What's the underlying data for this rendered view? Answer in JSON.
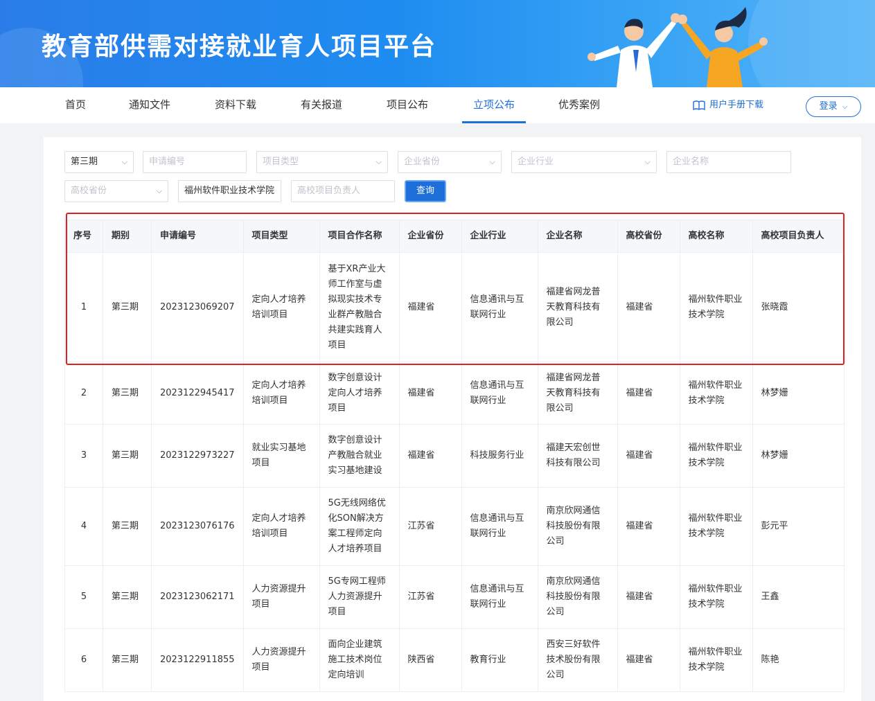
{
  "header": {
    "title": "教育部供需对接就业育人项目平台"
  },
  "nav": {
    "items": [
      {
        "label": "首页"
      },
      {
        "label": "通知文件"
      },
      {
        "label": "资料下载"
      },
      {
        "label": "有关报道"
      },
      {
        "label": "项目公布"
      },
      {
        "label": "立项公布"
      },
      {
        "label": "优秀案例"
      }
    ],
    "active": "立项公布",
    "manual_label": "用户手册下载",
    "login_label": "登录"
  },
  "filters": {
    "period_value": "第三期",
    "application_no_placeholder": "申请编号",
    "project_type_placeholder": "项目类型",
    "enterprise_province_placeholder": "企业省份",
    "enterprise_industry_placeholder": "企业行业",
    "enterprise_name_placeholder": "企业名称",
    "university_province_placeholder": "高校省份",
    "university_name_value": "福州软件职业技术学院",
    "university_leader_placeholder": "高校项目负责人",
    "query_label": "查询"
  },
  "table": {
    "headers": [
      "序号",
      "期别",
      "申请编号",
      "项目类型",
      "项目合作名称",
      "企业省份",
      "企业行业",
      "企业名称",
      "高校省份",
      "高校名称",
      "高校项目负责人"
    ],
    "rows": [
      [
        "1",
        "第三期",
        "2023123069207",
        "定向人才培养培训项目",
        "基于XR产业大师工作室与虚拟现实技术专业群产教融合共建实践育人项目",
        "福建省",
        "信息通讯与互联网行业",
        "福建省网龙普天教育科技有限公司",
        "福建省",
        "福州软件职业技术学院",
        "张晓霞"
      ],
      [
        "2",
        "第三期",
        "2023122945417",
        "定向人才培养培训项目",
        "数字创意设计定向人才培养项目",
        "福建省",
        "信息通讯与互联网行业",
        "福建省网龙普天教育科技有限公司",
        "福建省",
        "福州软件职业技术学院",
        "林梦姗"
      ],
      [
        "3",
        "第三期",
        "2023122973227",
        "就业实习基地项目",
        "数字创意设计产教融合就业实习基地建设",
        "福建省",
        "科技服务行业",
        "福建天宏创世科技有限公司",
        "福建省",
        "福州软件职业技术学院",
        "林梦姗"
      ],
      [
        "4",
        "第三期",
        "2023123076176",
        "定向人才培养培训项目",
        "5G无线网络优化SON解决方案工程师定向人才培养项目",
        "江苏省",
        "信息通讯与互联网行业",
        "南京欣网通信科技股份有限公司",
        "福建省",
        "福州软件职业技术学院",
        "彭元平"
      ],
      [
        "5",
        "第三期",
        "2023123062171",
        "人力资源提升项目",
        "5G专网工程师人力资源提升项目",
        "江苏省",
        "信息通讯与互联网行业",
        "南京欣网通信科技股份有限公司",
        "福建省",
        "福州软件职业技术学院",
        "王鑫"
      ],
      [
        "6",
        "第三期",
        "2023122911855",
        "人力资源提升项目",
        "面向企业建筑施工技术岗位定向培训",
        "陕西省",
        "教育行业",
        "西安三好软件技术股份有限公司",
        "福建省",
        "福州软件职业技术学院",
        "陈艳"
      ]
    ]
  },
  "colors": {
    "brand": "#1e6fd9",
    "highlight": "#e02020"
  }
}
